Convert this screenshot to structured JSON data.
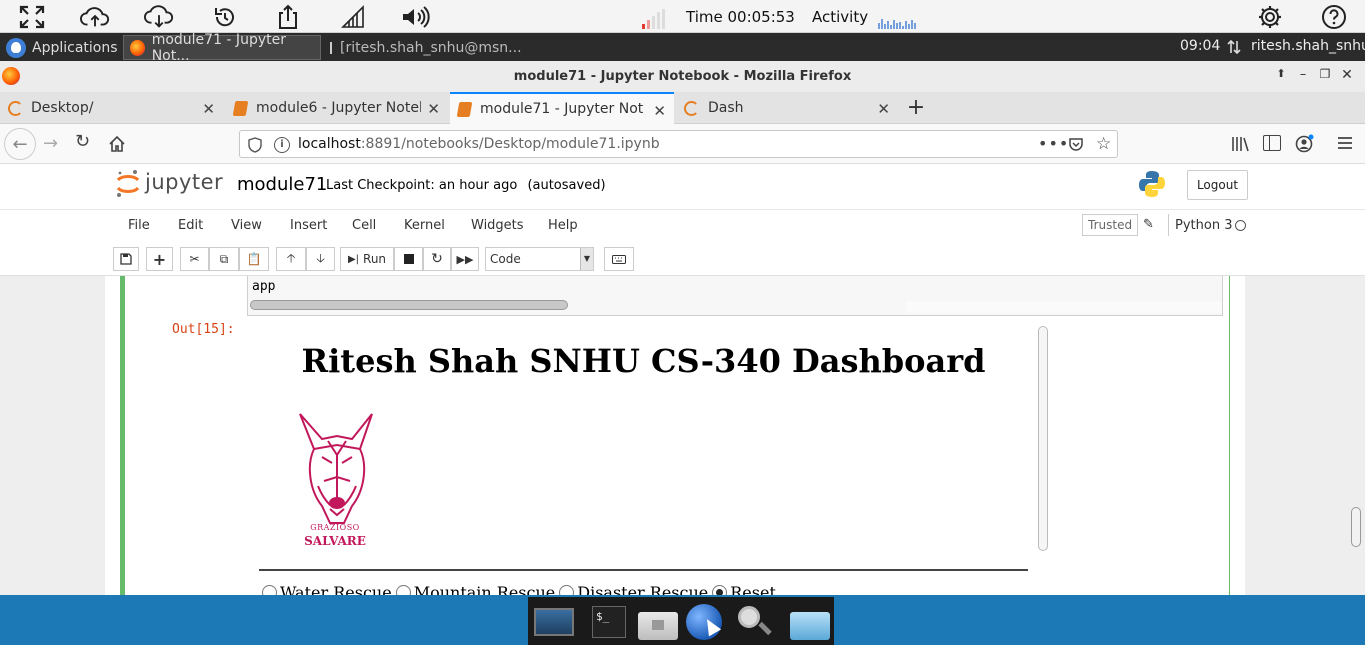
{
  "vnc": {
    "icons": [
      "fullscreen-icon",
      "cloud-upload-icon",
      "cloud-download-icon",
      "restore-icon",
      "share-icon",
      "signal-icon",
      "volume-icon",
      "settings-icon",
      "help-icon"
    ],
    "time_label": "Time 00:05:53",
    "activity_label": "Activity"
  },
  "panel": {
    "applications": "Applications",
    "tasks": [
      "module71 - Jupyter Not...",
      "[ritesh.shah_snhu@msn..."
    ],
    "clock": "09:04",
    "user": "ritesh.shah_snhu"
  },
  "window": {
    "title": "module71 - Jupyter Notebook - Mozilla Firefox"
  },
  "tabs": [
    {
      "label": "Desktop/",
      "active": false
    },
    {
      "label": "module6 - Jupyter Noteb",
      "active": false
    },
    {
      "label": "module71 - Jupyter Note",
      "active": true
    },
    {
      "label": "Dash",
      "active": false
    }
  ],
  "urlbar": {
    "host": "localhost",
    "path": ":8891/notebooks/Desktop/module71.ipynb"
  },
  "jupyter": {
    "logo_text": "jupyter",
    "notebook_name": "module71",
    "checkpoint": "Last Checkpoint: an hour ago",
    "autosaved": "(autosaved)",
    "logout": "Logout",
    "menu": [
      "File",
      "Edit",
      "View",
      "Insert",
      "Cell",
      "Kernel",
      "Widgets",
      "Help"
    ],
    "trusted": "Trusted",
    "kernel": "Python 3",
    "run_label": "Run",
    "cell_type": "Code"
  },
  "cell": {
    "code": "app",
    "out_prompt": "Out[15]:"
  },
  "dashboard": {
    "title": "Ritesh Shah SNHU CS-340 Dashboard",
    "logo_top": "GRAZIOSO",
    "logo_bottom": "SALVARE",
    "radios": [
      {
        "label": "Water Rescue",
        "checked": false
      },
      {
        "label": "Mountain Rescue",
        "checked": false
      },
      {
        "label": "Disaster Rescue",
        "checked": false
      },
      {
        "label": "Reset",
        "checked": true
      }
    ],
    "brand_color": "#c2185b"
  },
  "dock": {
    "items": [
      "desktop-icon",
      "terminal-icon",
      "home-folder-icon",
      "web-browser-icon",
      "search-icon",
      "folder-icon"
    ]
  }
}
